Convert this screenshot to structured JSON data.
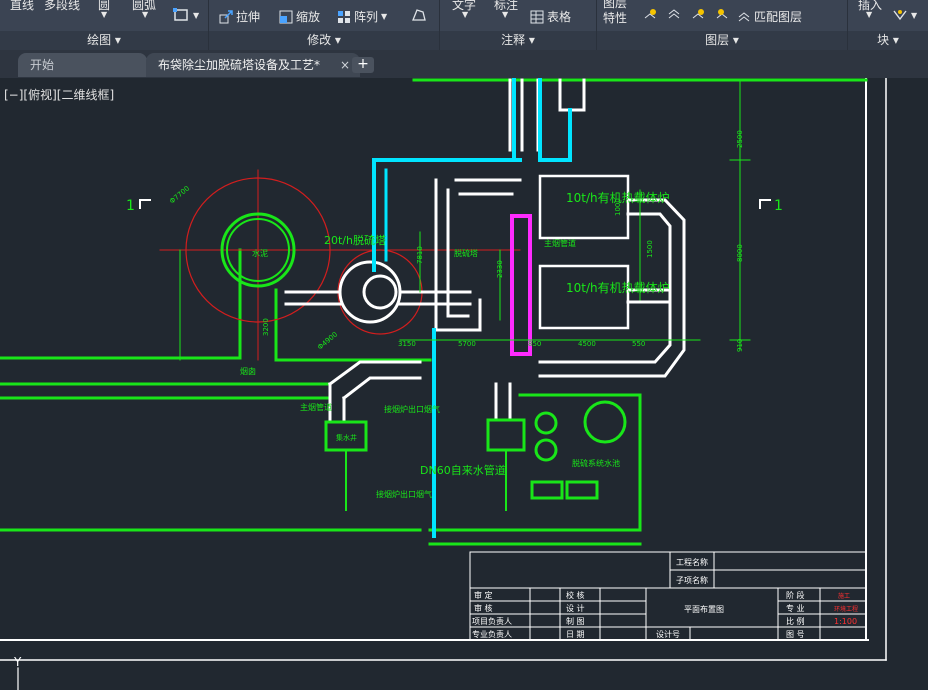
{
  "ribbon": {
    "draw": {
      "line": "直线",
      "polyline": "多段线",
      "circle": "圆",
      "arc": "圆弧",
      "panel": "绘图"
    },
    "modify": {
      "stretch": "拉伸",
      "scale": "缩放",
      "array": "阵列",
      "panel": "修改"
    },
    "annotation": {
      "text": "文字",
      "dimension": "标注",
      "table": "表格",
      "panel": "注释"
    },
    "layers": {
      "properties_top": "图层",
      "properties_bottom": "特性",
      "match": "匹配图层",
      "panel": "图层"
    },
    "block": {
      "insert": "插入",
      "panel": "块"
    }
  },
  "tabs": {
    "start": "开始",
    "document": "布袋除尘加脱硫塔设备及工艺*",
    "close": "×",
    "add": "+"
  },
  "viewport": {
    "label": "[−][俯视][二维线框]"
  },
  "drawing": {
    "mark_left": "1",
    "mark_right": "1",
    "equip_top": "10t/h有机热载体炉",
    "equip_bottom": "10t/h有机热载体炉",
    "label_20t": "20t/h脱硫塔",
    "label_dn60": "DN60自来水管道",
    "label_chimney": "烟囱",
    "label_shuini": "水泥",
    "label_desulf": "脱硫塔",
    "label_pump_pit": "集水井",
    "label_main_pipe": "主烟管道",
    "label_pipe1": "主烟管道",
    "label_smoke": "接烟炉出口烟气",
    "label_smoke2": "接烟炉出口烟气",
    "label_desulf_room": "脱硫系统水池",
    "label_dim_phi": "Φ7700",
    "label_dim_phi2": "Φ4900",
    "dims": {
      "d2500": "2500",
      "d8000": "8000",
      "d910": "910",
      "d3150": "3150",
      "d5700": "5700",
      "d850": "850",
      "d4500": "4500",
      "d550": "550",
      "d7810": "7810",
      "d2330": "2330",
      "d1500": "1500",
      "d3200": "3200",
      "d1000": "1000"
    }
  },
  "title_block": {
    "project_name": "工程名称",
    "sub_project": "子项名称",
    "approve": "审  定",
    "review": "审  核",
    "project_lead": "项目负责人",
    "discipline_lead": "专业负责人",
    "check": "校  核",
    "design": "设  计",
    "draw": "制  图",
    "date": "日  期",
    "drawing_title": "平面布置图",
    "design_no": "设计号",
    "stage": "阶  段",
    "specialty": "专  业",
    "scale": "比  例",
    "drawing_no": "图  号",
    "stage_val": "施工",
    "specialty_val": "环境工程",
    "scale_val": "1:100"
  },
  "ucs": {
    "y": "Y"
  },
  "colors": {
    "ribbon_bg": "#3b4453",
    "canvas_bg": "#212830",
    "green": "#19e619",
    "white": "#ffffff",
    "cyan": "#00e5ff",
    "magenta": "#ff2bff",
    "red": "#d21e1e"
  }
}
